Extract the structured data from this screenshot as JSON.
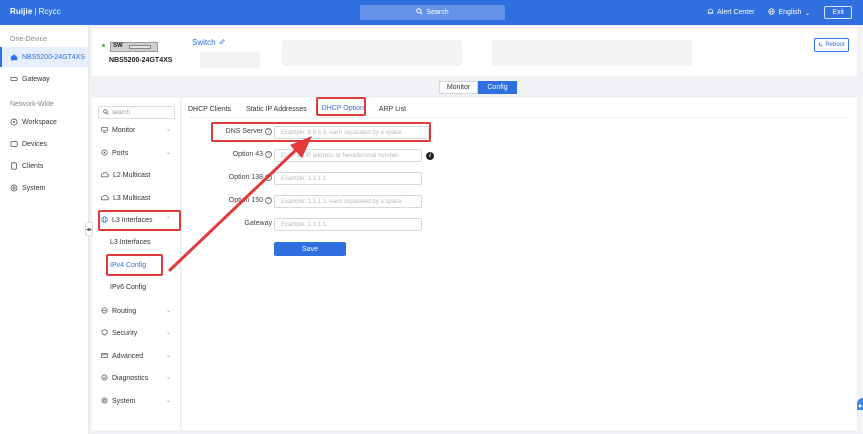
{
  "topbar": {
    "brand": "Ruijie",
    "brand_sub": "Rcycc",
    "search_placeholder": "Search",
    "alert_center": "Alert Center",
    "language": "English",
    "exit": "Exit"
  },
  "sidebar": {
    "section1": "One-Device",
    "device_item": "NBS5200-24GT4XS",
    "gateway": "Gateway",
    "section2": "Network-Wide",
    "workspace": "Workspace",
    "devices": "Devices",
    "clients": "Clients",
    "system": "System"
  },
  "device": {
    "badge": "SW",
    "model": "NBS5200-24GT4XS",
    "name": "Switch",
    "reboot": "Reboot"
  },
  "mode": {
    "monitor": "Monitor",
    "config": "Config"
  },
  "subnav": {
    "search_placeholder": "search",
    "monitor": "Monitor",
    "ports": "Ports",
    "l2_multicast": "L2 Multicast",
    "l3_multicast": "L3 Multicast",
    "l3_interfaces": "L3 Interfaces",
    "l3_interfaces_sub": "L3 Interfaces",
    "ipv4_config": "IPv4 Config",
    "ipv6_config": "IPv6 Config",
    "routing": "Routing",
    "security": "Security",
    "advanced": "Advanced",
    "diagnostics": "Diagnostics",
    "system": "System"
  },
  "tabs": [
    "DHCP Clients",
    "Static IP Addresses",
    "DHCP Option",
    "ARP List"
  ],
  "form": {
    "dns_label": "DNS Server",
    "dns_placeholder": "Example: 8.8.8.8, each separated by a space.",
    "opt43_label": "Option 43",
    "opt43_placeholder": "Enter an IP address or hexadecimal number.",
    "opt138_label": "Option 138",
    "opt138_placeholder": "Example: 1.1.1.1",
    "opt150_label": "Option 150",
    "opt150_placeholder": "Example: 1.1.1.1, each separated by a space.",
    "gateway_label": "Gateway",
    "gateway_placeholder": "Example: 1.1.1.1",
    "save": "Save"
  },
  "colors": {
    "accent": "#2f6fe0",
    "annotation": "#e23a3a"
  }
}
